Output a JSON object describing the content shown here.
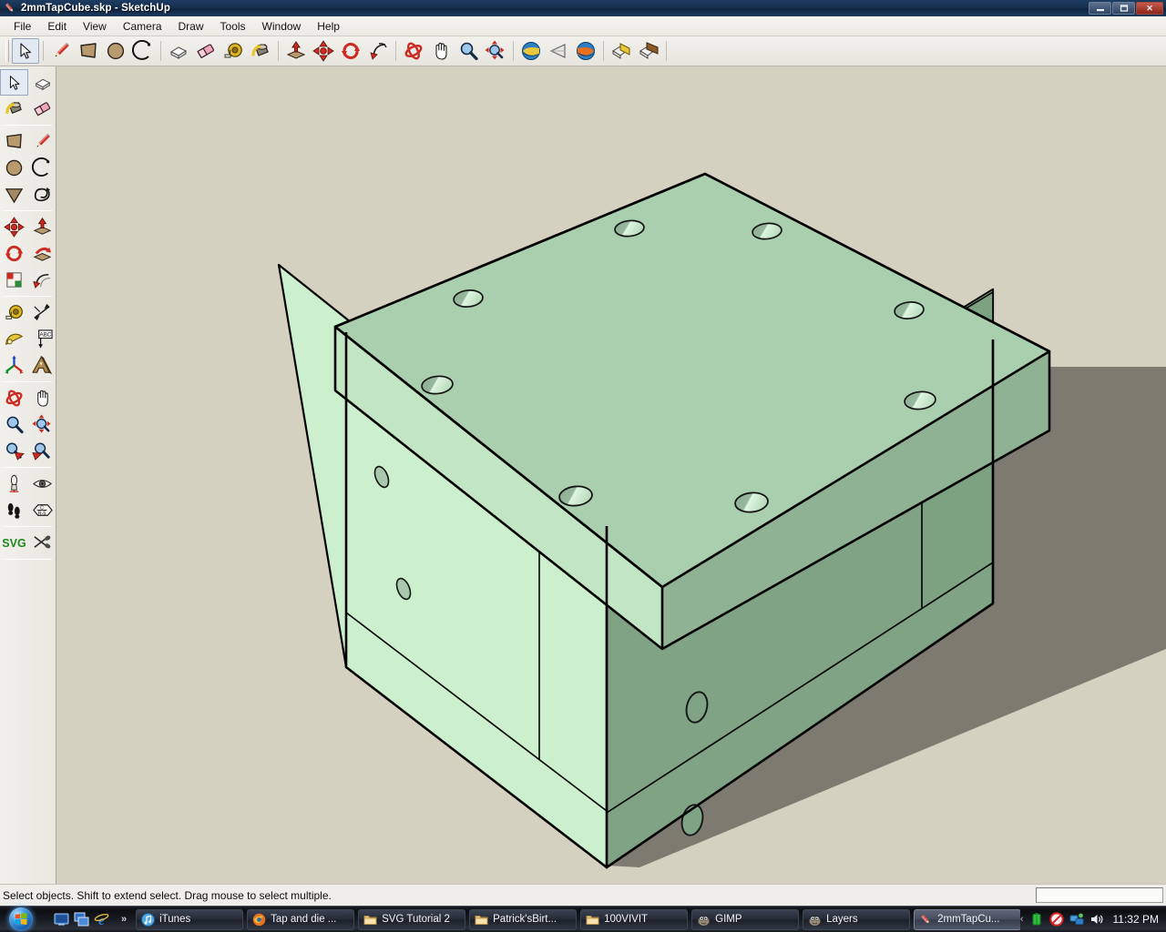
{
  "window": {
    "title": "2mmTapCube.skp - SketchUp",
    "app_icon": "sketchup-pencil-icon",
    "minimize_label": "–",
    "maximize_label": "❐",
    "close_label": "✕"
  },
  "menubar": {
    "items": [
      {
        "label": "File",
        "name": "menu-file"
      },
      {
        "label": "Edit",
        "name": "menu-edit"
      },
      {
        "label": "View",
        "name": "menu-view"
      },
      {
        "label": "Camera",
        "name": "menu-camera"
      },
      {
        "label": "Draw",
        "name": "menu-draw"
      },
      {
        "label": "Tools",
        "name": "menu-tools"
      },
      {
        "label": "Window",
        "name": "menu-window"
      },
      {
        "label": "Help",
        "name": "menu-help"
      }
    ]
  },
  "toolbar_top": {
    "groups": [
      {
        "items": [
          {
            "icon": "select-arrow-icon",
            "name": "tool-select",
            "active": true
          }
        ]
      },
      {
        "items": [
          {
            "icon": "pencil-line-icon",
            "name": "tool-line"
          },
          {
            "icon": "rectangle-icon",
            "name": "tool-rectangle"
          },
          {
            "icon": "circle-icon",
            "name": "tool-circle"
          },
          {
            "icon": "arc-icon",
            "name": "tool-arc"
          }
        ]
      },
      {
        "items": [
          {
            "icon": "make-component-icon",
            "name": "tool-make-component"
          },
          {
            "icon": "eraser-icon",
            "name": "tool-eraser"
          },
          {
            "icon": "tape-measure-icon",
            "name": "tool-tape-measure"
          },
          {
            "icon": "paint-bucket-icon",
            "name": "tool-paint-bucket"
          }
        ]
      },
      {
        "items": [
          {
            "icon": "push-pull-icon",
            "name": "tool-push-pull"
          },
          {
            "icon": "move-icon",
            "name": "tool-move"
          },
          {
            "icon": "rotate-icon",
            "name": "tool-rotate"
          },
          {
            "icon": "follow-me-icon",
            "name": "tool-follow-me"
          }
        ]
      },
      {
        "items": [
          {
            "icon": "orbit-icon",
            "name": "tool-orbit"
          },
          {
            "icon": "pan-hand-icon",
            "name": "tool-pan"
          },
          {
            "icon": "zoom-magnifier-icon",
            "name": "tool-zoom"
          },
          {
            "icon": "zoom-extents-icon",
            "name": "tool-zoom-extents"
          }
        ]
      },
      {
        "items": [
          {
            "icon": "previous-view-icon",
            "name": "tool-previous-view"
          },
          {
            "icon": "field-of-view-icon",
            "name": "tool-field-of-view"
          },
          {
            "icon": "next-view-icon",
            "name": "tool-next-view"
          }
        ]
      },
      {
        "items": [
          {
            "icon": "section-plane-icon",
            "name": "tool-section-plane"
          },
          {
            "icon": "section-display-icon",
            "name": "tool-section-display"
          }
        ]
      }
    ]
  },
  "toolbar_left": {
    "groups": [
      {
        "rows": [
          [
            {
              "icon": "select-arrow-icon",
              "name": "lt-tool-select",
              "active": true
            },
            {
              "icon": "make-component-icon",
              "name": "lt-tool-make-component"
            }
          ],
          [
            {
              "icon": "paint-bucket-icon",
              "name": "lt-tool-paint-bucket"
            },
            {
              "icon": "eraser-icon",
              "name": "lt-tool-eraser"
            }
          ]
        ]
      },
      {
        "rows": [
          [
            {
              "icon": "rectangle-icon",
              "name": "lt-tool-rectangle"
            },
            {
              "icon": "pencil-line-icon",
              "name": "lt-tool-line"
            }
          ],
          [
            {
              "icon": "circle-icon",
              "name": "lt-tool-circle"
            },
            {
              "icon": "arc-icon",
              "name": "lt-tool-arc"
            }
          ],
          [
            {
              "icon": "polygon-icon",
              "name": "lt-tool-polygon"
            },
            {
              "icon": "freehand-icon",
              "name": "lt-tool-freehand"
            }
          ]
        ]
      },
      {
        "rows": [
          [
            {
              "icon": "move-icon",
              "name": "lt-tool-move"
            },
            {
              "icon": "push-pull-icon",
              "name": "lt-tool-push-pull"
            }
          ],
          [
            {
              "icon": "rotate-icon",
              "name": "lt-tool-rotate"
            },
            {
              "icon": "follow-me-icon",
              "name": "lt-tool-follow-me"
            }
          ],
          [
            {
              "icon": "scale-icon",
              "name": "lt-tool-scale"
            },
            {
              "icon": "offset-icon",
              "name": "lt-tool-offset"
            }
          ]
        ]
      },
      {
        "rows": [
          [
            {
              "icon": "tape-measure-icon",
              "name": "lt-tool-tape-measure"
            },
            {
              "icon": "dimension-icon",
              "name": "lt-tool-dimension"
            }
          ],
          [
            {
              "icon": "protractor-icon",
              "name": "lt-tool-protractor"
            },
            {
              "icon": "text-label-icon",
              "name": "lt-tool-text"
            }
          ],
          [
            {
              "icon": "axes-icon",
              "name": "lt-tool-axes"
            },
            {
              "icon": "3d-text-icon",
              "name": "lt-tool-3d-text"
            }
          ]
        ]
      },
      {
        "rows": [
          [
            {
              "icon": "orbit-icon",
              "name": "lt-tool-orbit"
            },
            {
              "icon": "pan-hand-icon",
              "name": "lt-tool-pan"
            }
          ],
          [
            {
              "icon": "zoom-magnifier-icon",
              "name": "lt-tool-zoom"
            },
            {
              "icon": "zoom-extents-icon",
              "name": "lt-tool-zoom-extents"
            }
          ],
          [
            {
              "icon": "zoom-window-icon",
              "name": "lt-tool-zoom-window"
            },
            {
              "icon": "previous-view-icon",
              "name": "lt-tool-previous-view"
            }
          ]
        ]
      },
      {
        "rows": [
          [
            {
              "icon": "position-camera-icon",
              "name": "lt-tool-position-camera"
            },
            {
              "icon": "look-around-eye-icon",
              "name": "lt-tool-look-around"
            }
          ],
          [
            {
              "icon": "walk-footprints-icon",
              "name": "lt-tool-walk"
            },
            {
              "icon": "section-plane-icon",
              "name": "lt-tool-section-plane"
            }
          ]
        ]
      },
      {
        "rows": [
          [
            {
              "icon": "svg-export-label",
              "name": "lt-tool-svg-export",
              "label": "SVG"
            },
            {
              "icon": "svg-cut-icon",
              "name": "lt-tool-svg-cut"
            }
          ]
        ]
      }
    ],
    "svg_label": "SVG"
  },
  "viewport": {
    "background_color": "#d5d1c0",
    "ground_color": "#dcd8c6",
    "shadow_color": "#7d7a70",
    "model": {
      "name": "2mmTapCube",
      "top_face_color": "#a9cfae",
      "left_face_color": "#ccf0cd",
      "right_face_color": "#7fa384",
      "bevel_color": "#c2e6c3",
      "edge_color": "#000000",
      "top_face_holes": 8,
      "left_face_holes": 2,
      "right_face_holes": 2,
      "hole_fill": "#8eaf95",
      "hole_highlight": "#d6f1d8"
    }
  },
  "statusbar": {
    "message": "Select objects. Shift to extend select. Drag mouse to select multiple.",
    "vcb_label": "",
    "vcb_value": ""
  },
  "taskbar": {
    "start_name": "start-orb",
    "quick_launch": [
      {
        "icon": "show-desktop-icon",
        "name": "quicklaunch-show-desktop"
      },
      {
        "icon": "switch-windows-icon",
        "name": "quicklaunch-switch-windows"
      },
      {
        "icon": "internet-explorer-icon",
        "name": "quicklaunch-internet-explorer"
      }
    ],
    "quick_launch_overflow": "»",
    "tasks": [
      {
        "label": "iTunes",
        "icon": "itunes-icon",
        "active": false
      },
      {
        "label": "Tap and die ...",
        "icon": "firefox-icon",
        "active": false
      },
      {
        "label": "SVG Tutorial 2",
        "icon": "folder-icon",
        "active": false
      },
      {
        "label": "Patrick'sBirt...",
        "icon": "folder-icon",
        "active": false
      },
      {
        "label": "100VIVIT",
        "icon": "folder-icon",
        "active": false
      },
      {
        "label": "GIMP",
        "icon": "gimp-wilber-icon",
        "active": false
      },
      {
        "label": "Layers",
        "icon": "gimp-wilber-icon",
        "active": false
      },
      {
        "label": "2mmTapCu...",
        "icon": "sketchup-pencil-icon",
        "active": true
      }
    ],
    "tray": {
      "expand_chevron": "‹",
      "icons": [
        {
          "icon": "battery-icon",
          "name": "tray-battery"
        },
        {
          "icon": "action-center-blocked-icon",
          "name": "tray-action-center"
        },
        {
          "icon": "network-icon",
          "name": "tray-network"
        },
        {
          "icon": "volume-speaker-icon",
          "name": "tray-volume"
        }
      ],
      "clock": "11:32 PM"
    }
  }
}
